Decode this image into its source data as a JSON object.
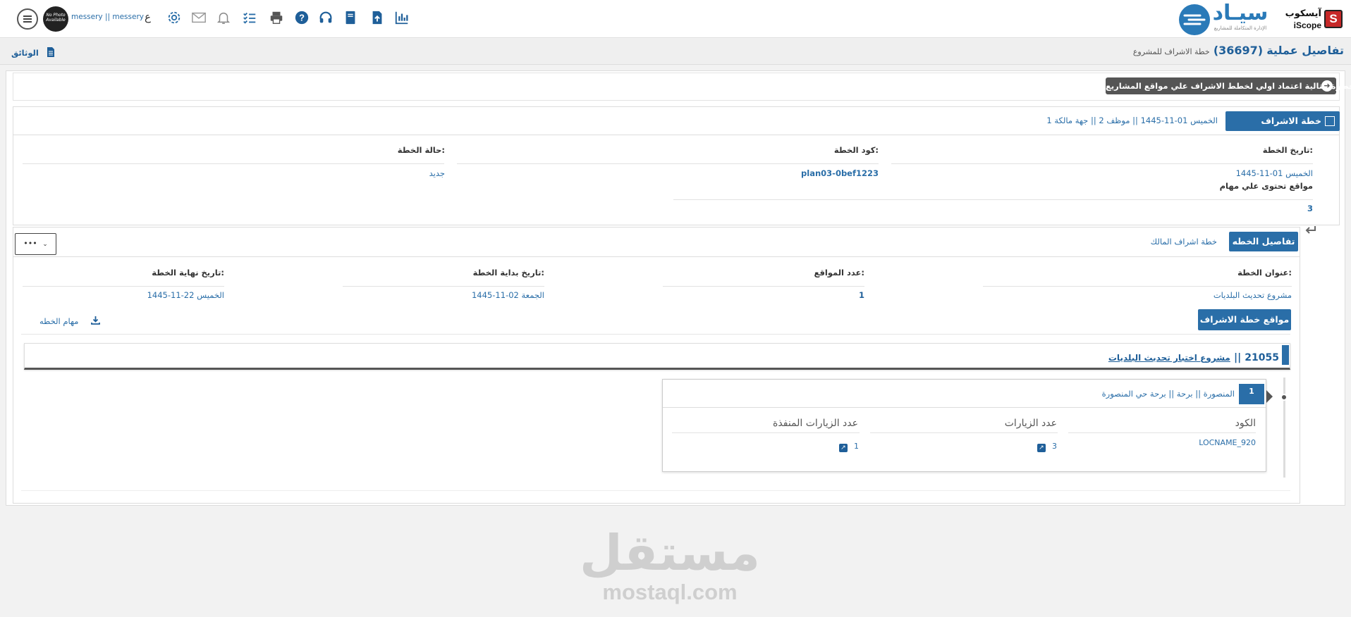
{
  "header": {
    "brand_iscope_ar": "آيسكوب",
    "brand_iscope_en": "iScope",
    "brand_siad": "سيـاد",
    "brand_siad_sub": "الإدارة المتكاملة للمشاريع",
    "user_name": "messery || messery",
    "avatar_text": "No Photo Available",
    "lang_toggle": "ع",
    "accent_color": "#2a6ea8"
  },
  "subheader": {
    "title_prefix": "تفاصيل عملية",
    "operation_id": "(36697)",
    "subtitle": "خطة الاشراف للمشروع",
    "documents_label": "الوثائق"
  },
  "next_step_label": "الخطوة التالية اعتماد اولي لخطط الاشراف علي مواقع المشاريع",
  "plan_panel": {
    "tab_label": "خطة الاشراف للمشروع",
    "summary": "الخميس 01-11-1445 || موظف 2 || جهة مالكة 1",
    "fields": {
      "plan_date_label": "تاريخ الخطة:",
      "plan_date_value": "الخميس 01-11-1445",
      "plan_code_label": "كود الخطة:",
      "plan_code_value": "plan03-0bef1223",
      "plan_status_label": "حالة الخطة:",
      "plan_status_value": "جديد",
      "sites_with_tasks_label": "مواقع تحتوى علي مهام",
      "sites_with_tasks_value": "3"
    }
  },
  "tabs": {
    "active": "تفاصيل الخطه",
    "other": "خطة اشراف المالك",
    "more": "•••"
  },
  "details": {
    "title_label": "عنوان الخطة:",
    "title_value": "مشروع تحديث البلديات",
    "sites_count_label": "عدد المواقع:",
    "sites_count_value": "1",
    "start_label": "تاريخ بداية الخطة:",
    "start_value": "الجمعة 02-11-1445",
    "end_label": "تاريخ نهاية الخطة:",
    "end_value": "الخميس 22-11-1445",
    "sites_button": "مواقع خطة الاشراف",
    "tasks_link": "مهام الخطه"
  },
  "project": {
    "id": "21055",
    "sep": "||",
    "name": "مشروع اختبار تحديث البلديات"
  },
  "site": {
    "index": "1",
    "path": "المنصورة || برحة || برحة حي المنصورة",
    "columns": [
      "الكود",
      "عدد الزيارات",
      "عدد الزيارات المنفذة"
    ],
    "row": {
      "code": "LOCNAME_920",
      "visits": "3",
      "done_visits": "1"
    }
  },
  "watermark": {
    "ar": "مستقل",
    "en": "mostaql.com"
  }
}
